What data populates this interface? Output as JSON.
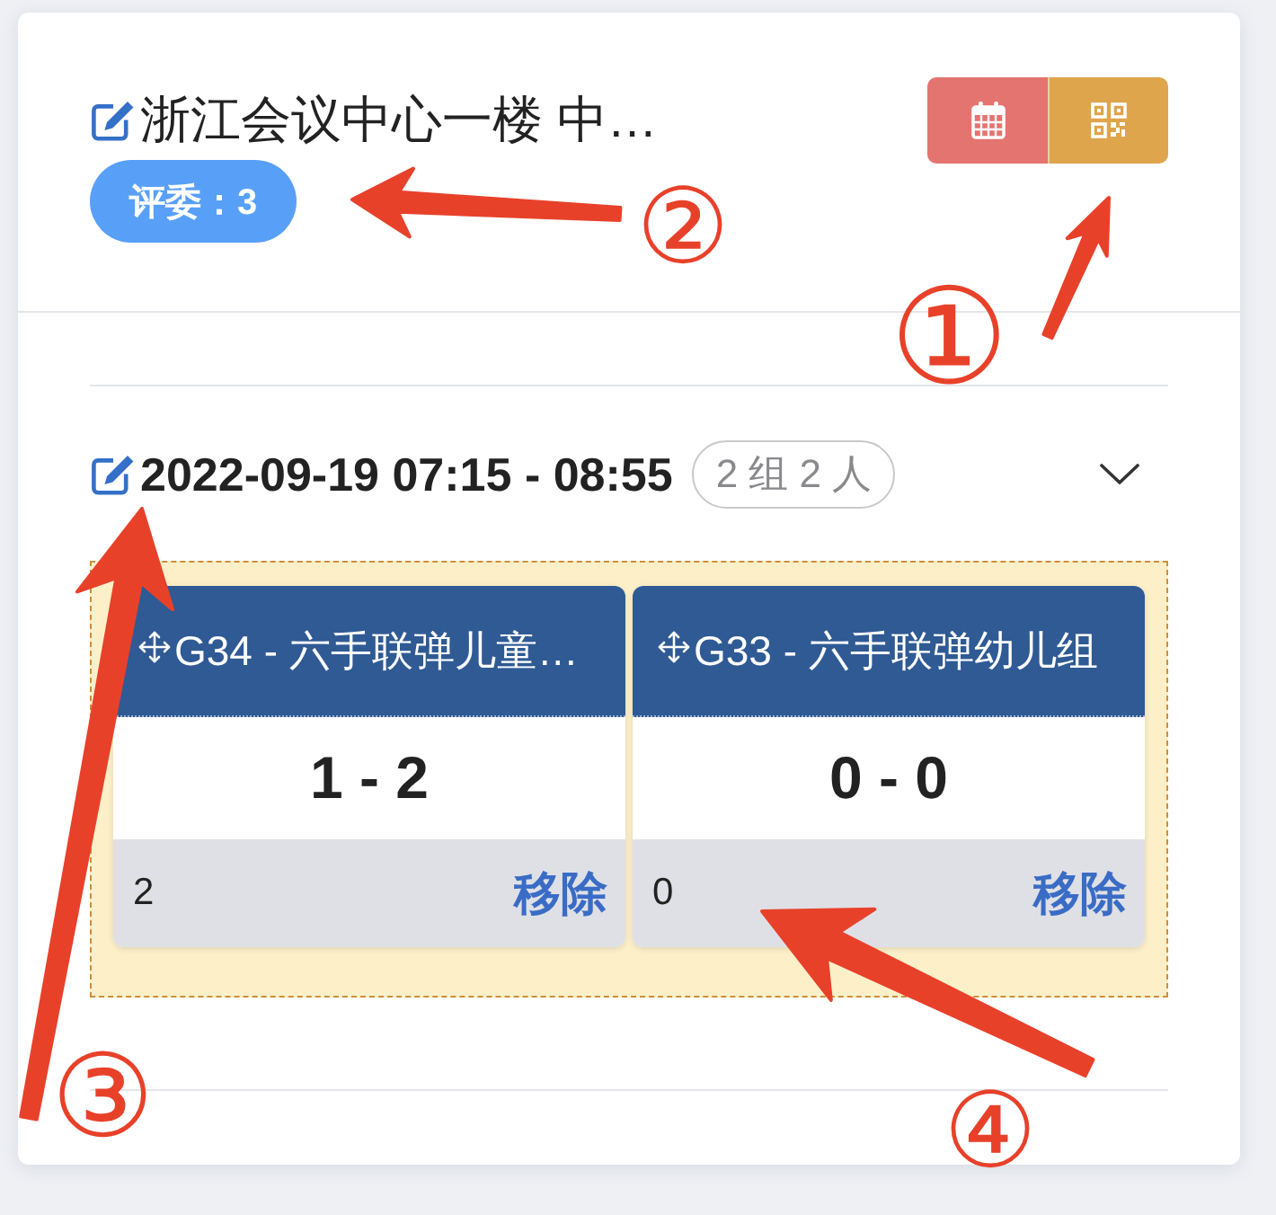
{
  "venue": {
    "title": "浙江会议中心一楼 中…",
    "judges": "评委：3",
    "actions": [
      {
        "kind": "calendar"
      },
      {
        "kind": "qrcode"
      }
    ]
  },
  "session": {
    "time": "2022-09-19 07:15 - 08:55",
    "summary": "2 组 2 人",
    "groups": [
      {
        "title": "G34 - 六手联弹儿童…",
        "score": "1 - 2",
        "count": "2",
        "action": "移除"
      },
      {
        "title": "G33 - 六手联弹幼儿组",
        "score": "0 - 0",
        "count": "0",
        "action": "移除"
      }
    ]
  },
  "annotations": [
    {
      "number": "①"
    },
    {
      "number": "②"
    },
    {
      "number": "③"
    },
    {
      "number": "④"
    }
  ]
}
